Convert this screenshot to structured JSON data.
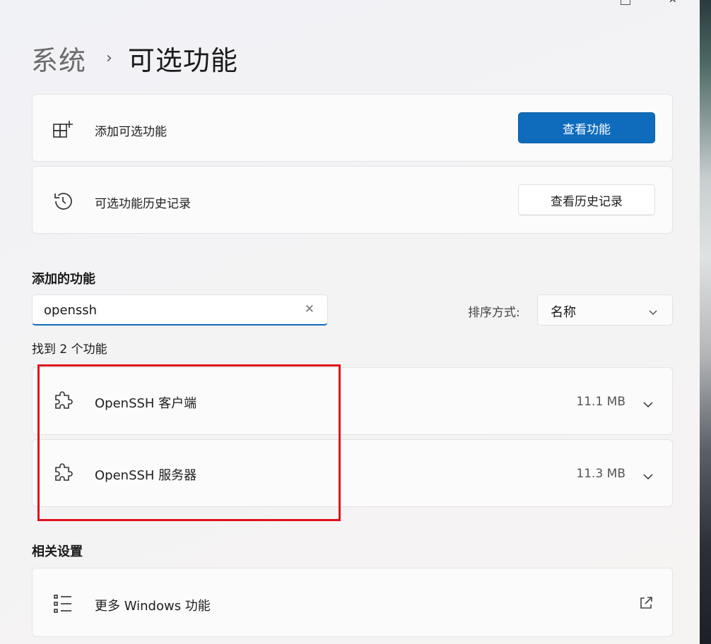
{
  "breadcrumb": {
    "parent": "系统",
    "separator": "›",
    "current": "可选功能"
  },
  "add_feature": {
    "label": "添加可选功能",
    "button": "查看功能",
    "icon": "add-grid-icon"
  },
  "history": {
    "label": "可选功能历史记录",
    "button": "查看历史记录",
    "icon": "history-icon"
  },
  "added_section": {
    "title": "添加的功能",
    "search_value": "openssh",
    "sort_label": "排序方式:",
    "sort_value": "名称",
    "result_count": "找到 2 个功能"
  },
  "features": [
    {
      "name": "OpenSSH 客户端",
      "size": "11.1 MB",
      "icon": "puzzle-icon"
    },
    {
      "name": "OpenSSH 服务器",
      "size": "11.3 MB",
      "icon": "puzzle-icon"
    }
  ],
  "related": {
    "title": "相关设置",
    "more_windows_features": "更多 Windows 功能",
    "icon": "list-icon"
  },
  "colors": {
    "accent": "#0f6cbd",
    "highlight_border": "#e0121b"
  }
}
